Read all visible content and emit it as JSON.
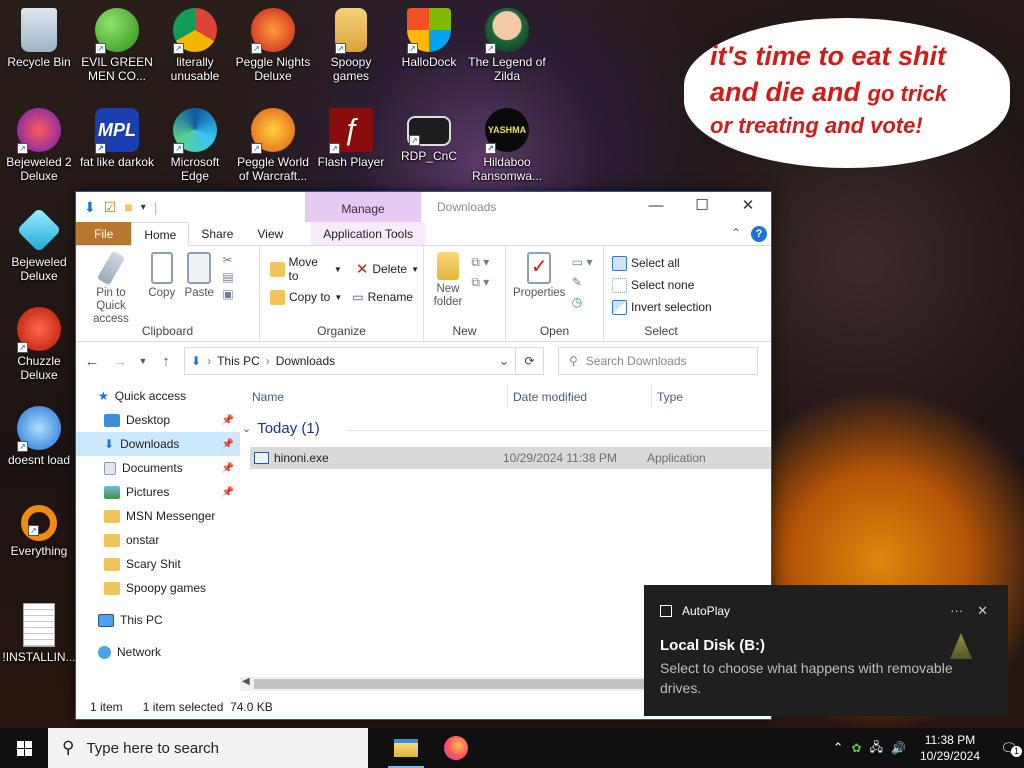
{
  "desktop": {
    "icons": [
      {
        "label": "Recycle Bin"
      },
      {
        "label": "EVIL GREEN MEN CO..."
      },
      {
        "label": "literally unusable"
      },
      {
        "label": "Peggle Nights Deluxe"
      },
      {
        "label": "Spoopy games"
      },
      {
        "label": "HalloDock"
      },
      {
        "label": "The Legend of Zilda"
      },
      {
        "label": "Bejeweled 2 Deluxe"
      },
      {
        "label": "fat like darkok"
      },
      {
        "label": "Microsoft Edge"
      },
      {
        "label": "Peggle World of Warcraft..."
      },
      {
        "label": "Flash Player"
      },
      {
        "label": "RDP_CnC"
      },
      {
        "label": "Hildaboo Ransomwa..."
      },
      {
        "label": "Bejeweled Deluxe"
      },
      {
        "label": "Chuzzle Deluxe"
      },
      {
        "label": "doesnt load"
      },
      {
        "label": "Everything"
      },
      {
        "label": "!INSTALLIN..."
      }
    ],
    "bubble": {
      "line1": "it's time to eat shit",
      "line2a": "and die and ",
      "line2b": "go trick",
      "line3": "or treating and vote!"
    },
    "icon_logo_text": {
      "mpl": "MPL",
      "yashma": "YASHMA"
    }
  },
  "explorer": {
    "title": "Downloads",
    "context_tab": "Manage",
    "tabs": {
      "file": "File",
      "home": "Home",
      "share": "Share",
      "view": "View",
      "app_tools": "Application Tools"
    },
    "window_controls": {
      "minimize": "—",
      "maximize": "☐",
      "close": "✕"
    },
    "ribbon": {
      "clipboard": {
        "label": "Clipboard",
        "pin": "Pin to Quick access",
        "copy": "Copy",
        "paste": "Paste"
      },
      "organize": {
        "label": "Organize",
        "move_to": "Move to",
        "copy_to": "Copy to",
        "delete": "Delete",
        "rename": "Rename"
      },
      "new": {
        "label": "New",
        "new_folder": "New folder"
      },
      "open": {
        "label": "Open",
        "properties": "Properties"
      },
      "select": {
        "label": "Select",
        "select_all": "Select all",
        "select_none": "Select none",
        "invert": "Invert selection"
      }
    },
    "address": {
      "root": "This PC",
      "current": "Downloads",
      "search_placeholder": "Search Downloads"
    },
    "nav": {
      "quick_access": "Quick access",
      "items": [
        "Desktop",
        "Downloads",
        "Documents",
        "Pictures",
        "MSN Messenger",
        "onstar",
        "Scary Shit",
        "Spoopy games"
      ],
      "this_pc": "This PC",
      "network": "Network"
    },
    "columns": {
      "name": "Name",
      "date": "Date modified",
      "type": "Type"
    },
    "group": "Today (1)",
    "file": {
      "name": "hinoni.exe",
      "date": "10/29/2024 11:38 PM",
      "type": "Application"
    },
    "status": {
      "count": "1 item",
      "selected": "1 item selected",
      "size": "74.0 KB"
    }
  },
  "toast": {
    "app": "AutoPlay",
    "more": "···",
    "close": "✕",
    "title": "Local Disk (B:)",
    "message": "Select to choose what happens with removable drives."
  },
  "taskbar": {
    "search_placeholder": "Type here to search",
    "time": "11:38 PM",
    "date": "10/29/2024",
    "notification_count": "1"
  },
  "colors": {
    "accent": "#2b579a",
    "file_tab": "#b7772e",
    "manage_tab": "#e7c9f3",
    "selected": "#cce8ff",
    "folder": "#f2c45a"
  }
}
